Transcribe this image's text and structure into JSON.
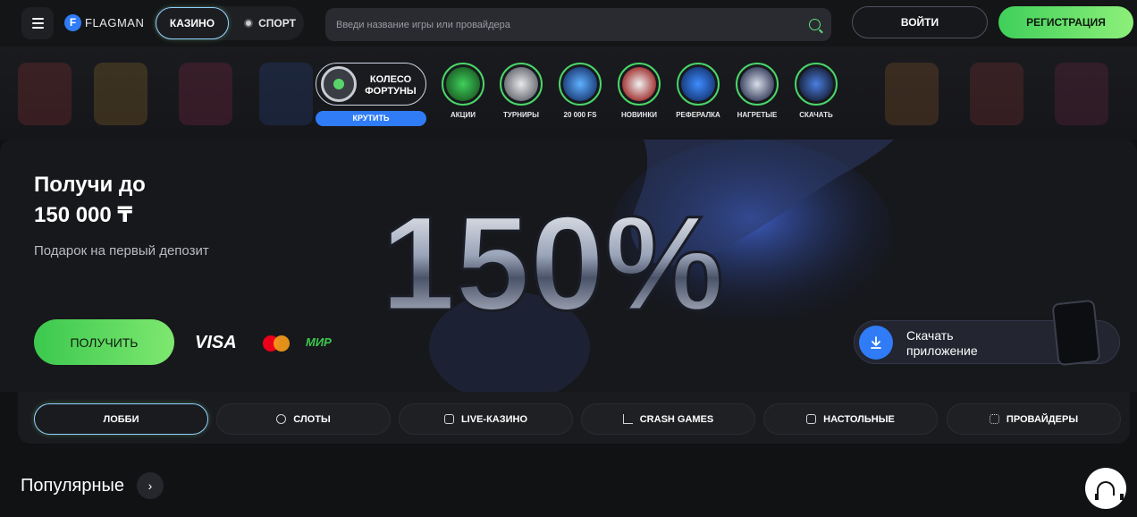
{
  "header": {
    "logo": "FLAGMAN",
    "logo_mark": "F",
    "modes": {
      "casino": "КАЗИНО",
      "sport": "СПОРТ"
    },
    "search": {
      "placeholder": "Введи название игры или провайдера"
    },
    "login_label": "ВОЙТИ",
    "register_label": "РЕГИСТРАЦИЯ"
  },
  "wheel": {
    "label": "КОЛЕСО ФОРТУНЫ",
    "button": "КРУТИТЬ"
  },
  "stories": [
    {
      "label": "АКЦИИ",
      "icon": "gift-icon",
      "color": "#3fcf5a"
    },
    {
      "label": "ТУРНИРЫ",
      "icon": "trophy-icon",
      "color": "#c9ccd2"
    },
    {
      "label": "20 000 FS",
      "icon": "free-spins-icon",
      "color": "#2f7cf6"
    },
    {
      "label": "НОВИНКИ",
      "icon": "gamepad-icon",
      "color": "#e04848"
    },
    {
      "label": "РЕФЕРАЛКА",
      "icon": "money-bag-icon",
      "color": "#2f7cf6"
    },
    {
      "label": "НАГРЕТЫЕ",
      "icon": "rocket-icon",
      "color": "#8aa0c8"
    },
    {
      "label": "СКАЧАТЬ",
      "icon": "app-icon",
      "color": "#3b6ed0"
    }
  ],
  "hero": {
    "title_line1": "Получи до",
    "title_line2": "150 000 ₸",
    "subtitle": "Подарок на первый депозит",
    "big_number": "150%",
    "cta": "ПОЛУЧИТЬ",
    "payments": {
      "visa": "VISA",
      "mir": "МИР"
    },
    "app_cta_line1": "Скачать",
    "app_cta_line2": "приложение"
  },
  "categories": [
    {
      "label": "ЛОББИ",
      "icon": "",
      "active": true
    },
    {
      "label": "СЛОТЫ",
      "icon": "slots-icon",
      "active": false
    },
    {
      "label": "LIVE-КАЗИНО",
      "icon": "live-casino-icon",
      "active": false
    },
    {
      "label": "CRASH GAMES",
      "icon": "crash-chart-icon",
      "active": false
    },
    {
      "label": "НАСТОЛЬНЫЕ",
      "icon": "dice-icon",
      "active": false
    },
    {
      "label": "ПРОВАЙДЕРЫ",
      "icon": "grid-icon",
      "active": false
    }
  ],
  "popular": {
    "title": "Популярные"
  },
  "colors": {
    "accent_green": "#3fcf5a",
    "accent_blue": "#2f7cf6",
    "background": "#111214"
  }
}
